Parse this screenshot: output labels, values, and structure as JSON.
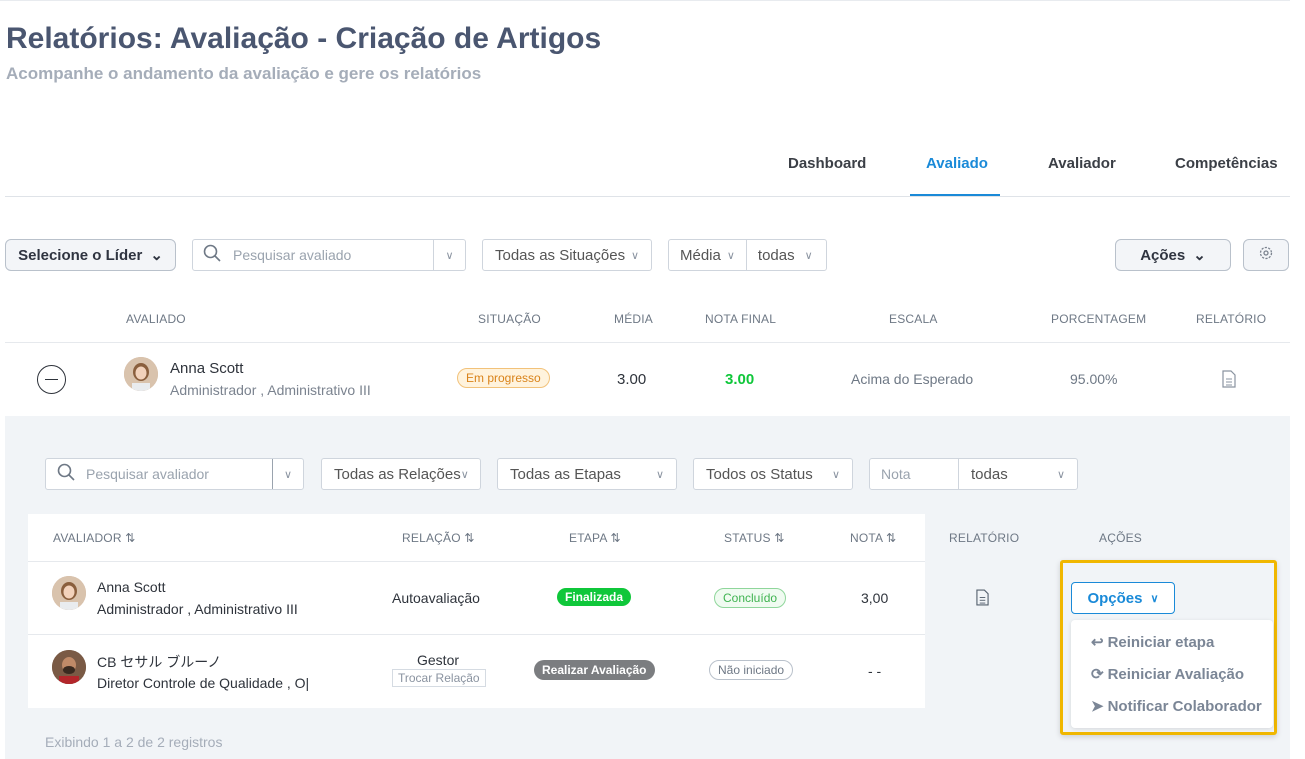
{
  "page": {
    "title": "Relatórios: Avaliação - Criação de Artigos",
    "subtitle": "Acompanhe o andamento da avaliação e gere os relatórios"
  },
  "tabs": [
    "Dashboard",
    "Avaliado",
    "Avaliador",
    "Competências"
  ],
  "active_tab": "Avaliado",
  "filters": {
    "leader_label": "Selecione o Líder",
    "search_placeholder": "Pesquisar avaliado",
    "situations": "Todas as Situações",
    "media": "Média",
    "todas": "todas",
    "actions_label": "Ações"
  },
  "main_table": {
    "headers": [
      "AVALIADO",
      "SITUAÇÃO",
      "MÉDIA",
      "NOTA FINAL",
      "ESCALA",
      "PORCENTAGEM",
      "RELATÓRIO"
    ],
    "row": {
      "name": "Anna Scott",
      "role": "Administrador , Administrativo III",
      "situation": "Em progresso",
      "media": "3.00",
      "nota_final": "3.00",
      "escala": "Acima do Esperado",
      "porcentagem": "95.00%"
    }
  },
  "sub_filters": {
    "search_placeholder": "Pesquisar avaliador",
    "relations": "Todas as Relações",
    "stages": "Todas as Etapas",
    "status": "Todos os Status",
    "nota_placeholder": "Nota",
    "todas": "todas"
  },
  "sub_table": {
    "headers": [
      "AVALIADOR",
      "RELAÇÃO",
      "ETAPA",
      "STATUS",
      "NOTA",
      "RELATÓRIO",
      "AÇÕES"
    ],
    "rows": [
      {
        "name": "Anna Scott",
        "role": "Administrador , Administrativo III",
        "relation": "Autoavaliação",
        "stage": "Finalizada",
        "status": "Concluído",
        "nota": "3,00",
        "action": "Opções"
      },
      {
        "name": "CB セサル ブルーノ",
        "role": "Diretor Controle de Qualidade , O|",
        "relation": "Gestor",
        "relation_link": "Trocar Relação",
        "stage": "Realizar Avaliação",
        "status": "Não iniciado",
        "nota": "- -"
      }
    ],
    "footer": "Exibindo 1 a 2 de 2 registros"
  },
  "options_menu": [
    "Reiniciar etapa",
    "Reiniciar Avaliação",
    "Notificar Colaborador"
  ],
  "colors": {
    "accent": "#1a8ad8",
    "success": "#0fc73a",
    "highlight": "#f0b700"
  }
}
